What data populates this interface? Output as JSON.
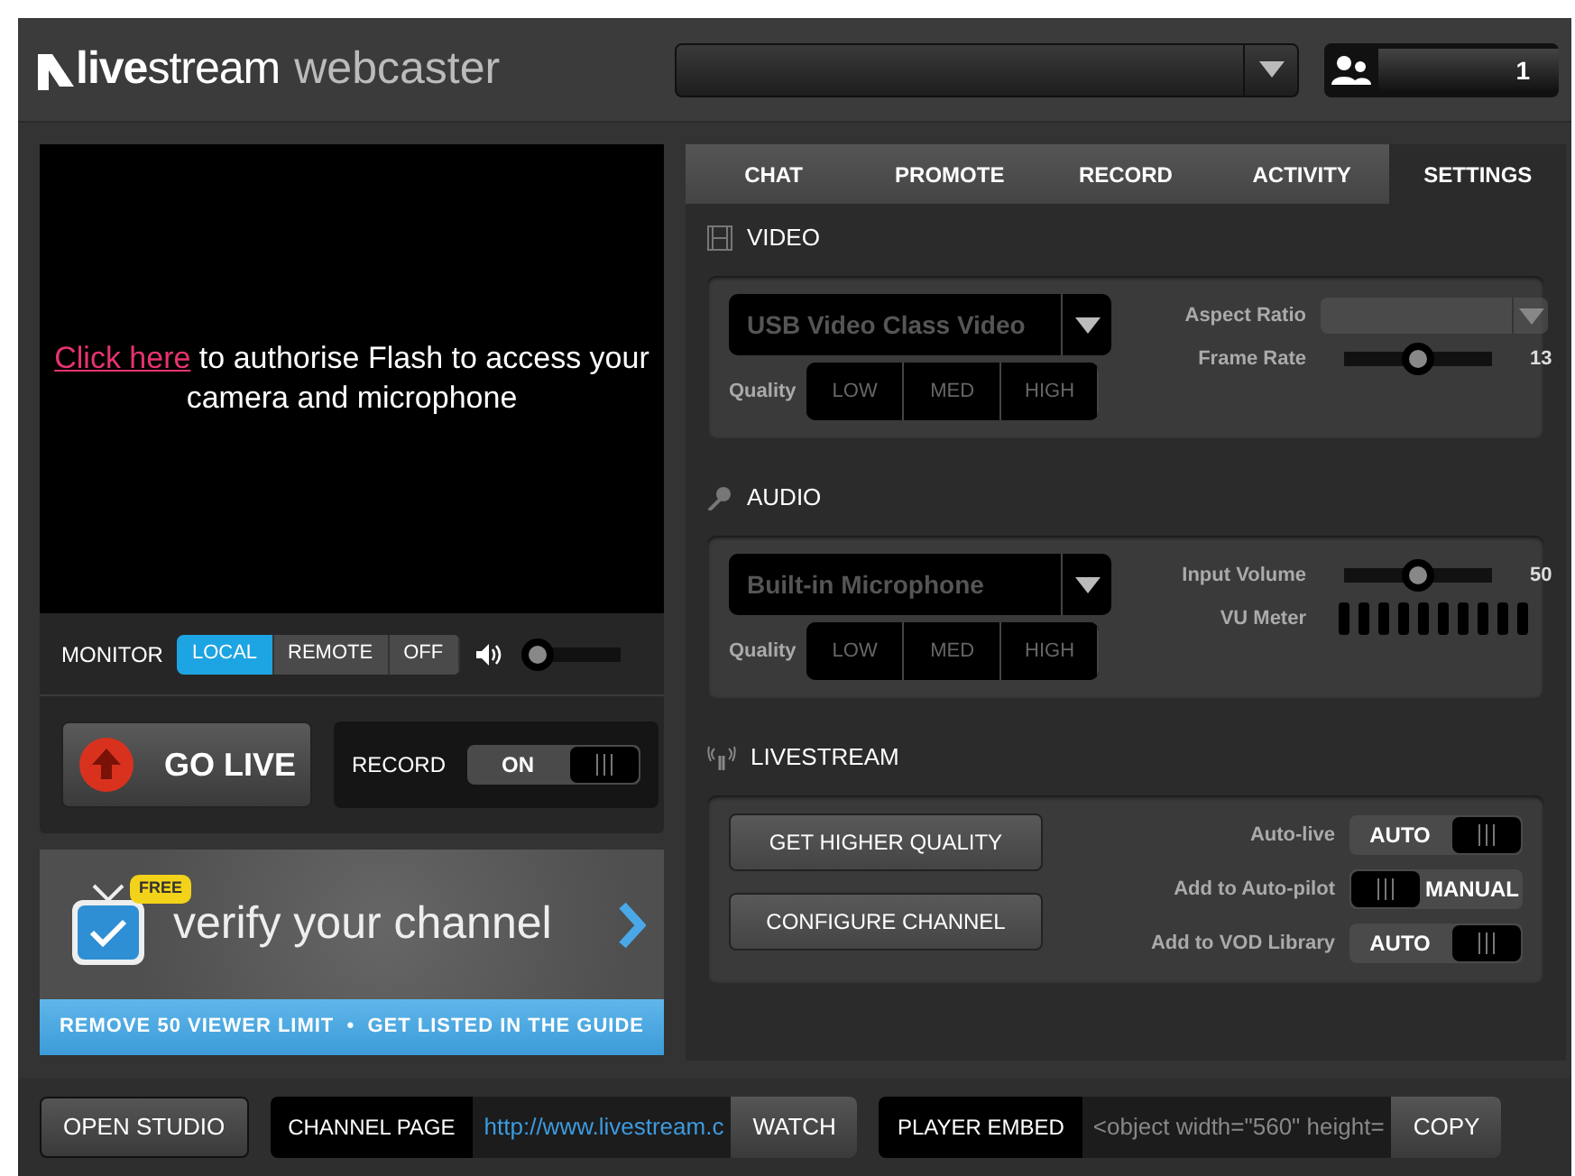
{
  "header": {
    "logo_brand": "**live**stream",
    "logo_product": "webcaster",
    "viewer_count": "1"
  },
  "preview": {
    "link": "Click here",
    "message": " to authorise Flash to access your camera and microphone"
  },
  "monitor": {
    "label": "MONITOR",
    "options": [
      {
        "label": "LOCAL",
        "selected": true
      },
      {
        "label": "REMOTE",
        "selected": false
      },
      {
        "label": "OFF",
        "selected": false
      }
    ],
    "volume": {
      "level": 0.04
    }
  },
  "go_live": {
    "label": "GO LIVE"
  },
  "record": {
    "label": "RECORD",
    "toggle": {
      "text": "ON",
      "on": true
    }
  },
  "promo": {
    "badge": "FREE",
    "title": "verify your channel",
    "footer": "REMOVE 50 VIEWER LIMIT  •  GET LISTED IN THE GUIDE"
  },
  "tabs": [
    {
      "label": "CHAT",
      "selected": false
    },
    {
      "label": "PROMOTE",
      "selected": false
    },
    {
      "label": "RECORD",
      "selected": false
    },
    {
      "label": "ACTIVITY",
      "selected": false
    },
    {
      "label": "SETTINGS",
      "selected": true
    }
  ],
  "video": {
    "title": "VIDEO",
    "device": "USB Video Class Video",
    "quality_label": "Quality",
    "quality": [
      {
        "label": "LOW",
        "selected": false
      },
      {
        "label": "MED",
        "selected": false
      },
      {
        "label": "HIGH",
        "selected": false
      }
    ],
    "aspect_ratio": {
      "label": "Aspect Ratio",
      "disabled": true
    },
    "frame_rate": {
      "label": "Frame Rate",
      "level": 0.5,
      "reading": "13"
    }
  },
  "audio": {
    "title": "AUDIO",
    "device": "Built-in Microphone",
    "quality_label": "Quality",
    "quality": [
      {
        "label": "LOW",
        "selected": false
      },
      {
        "label": "MED",
        "selected": false
      },
      {
        "label": "HIGH",
        "selected": false
      }
    ],
    "input_volume": {
      "label": "Input Volume",
      "level": 0.5,
      "reading": "50"
    },
    "vu_meter": {
      "label": "VU Meter"
    }
  },
  "livestream": {
    "title": "LIVESTREAM",
    "buttons": [
      "GET HIGHER QUALITY",
      "CONFIGURE CHANNEL"
    ],
    "options": [
      {
        "label": "Auto-live",
        "text": "AUTO",
        "on": true
      },
      {
        "label": "Add to Auto-pilot",
        "text": "MANUAL",
        "on": false
      },
      {
        "label": "Add to VOD Library",
        "text": "AUTO",
        "on": true
      }
    ]
  },
  "footer": {
    "open_studio": "OPEN STUDIO",
    "channel_page": {
      "label": "CHANNEL PAGE",
      "value": "http://www.livestream.c",
      "action": "WATCH"
    },
    "player_embed": {
      "label": "PLAYER EMBED",
      "value": "<object width=\"560\" height=",
      "action": "COPY"
    }
  }
}
